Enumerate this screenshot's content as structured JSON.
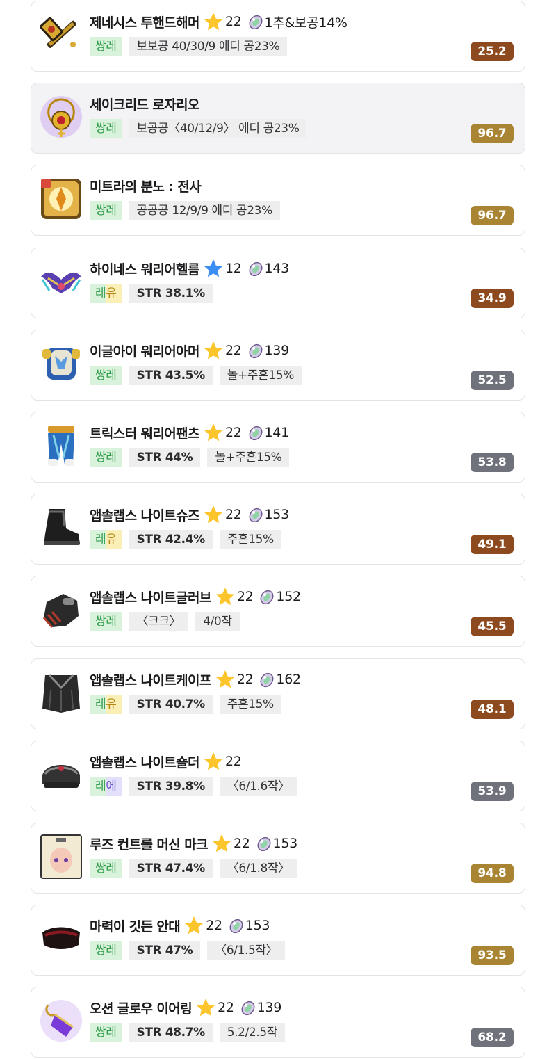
{
  "colors": {
    "score_brown": "#8e4a1f",
    "score_gold": "#a98432",
    "score_gray": "#6f717b",
    "star_gold": "#fdc52c",
    "star_blue": "#3b8ff2"
  },
  "items": [
    {
      "name": "제네시스 투핸드해머",
      "icon": "hammer-icon",
      "star": "gold",
      "stars": "22",
      "gem": "1추&보공14%",
      "rank": {
        "a": "쌍",
        "b": "레",
        "style": "green"
      },
      "tags": [
        {
          "text": "보보공 40/30/9 에디 공23%",
          "bold": false
        }
      ],
      "score": "25.2",
      "score_color": "brown",
      "highlighted": false
    },
    {
      "name": "세이크리드 로자리오",
      "icon": "rosary-icon",
      "star": null,
      "stars": null,
      "gem": null,
      "rank": {
        "a": "쌍",
        "b": "레",
        "style": "green"
      },
      "tags": [
        {
          "text": "보공공〈40/12/9〉 에디 공23%",
          "bold": false
        }
      ],
      "score": "96.7",
      "score_color": "gold",
      "highlighted": true
    },
    {
      "name": "미트라의 분노 : 전사",
      "icon": "emblem-icon",
      "star": null,
      "stars": null,
      "gem": null,
      "rank": {
        "a": "쌍",
        "b": "레",
        "style": "green"
      },
      "tags": [
        {
          "text": "공공공 12/9/9 에디 공23%",
          "bold": false
        }
      ],
      "score": "96.7",
      "score_color": "gold",
      "highlighted": false
    },
    {
      "name": "하이네스 워리어헬름",
      "icon": "helmet-icon",
      "star": "blue",
      "stars": "12",
      "gem": "143",
      "rank": {
        "a": "레",
        "b": "유",
        "style": "unique"
      },
      "tags": [
        {
          "text": "STR 38.1%",
          "bold": true
        }
      ],
      "score": "34.9",
      "score_color": "brown",
      "highlighted": false
    },
    {
      "name": "이글아이 워리어아머",
      "icon": "armor-icon",
      "star": "gold",
      "stars": "22",
      "gem": "139",
      "rank": {
        "a": "쌍",
        "b": "레",
        "style": "green"
      },
      "tags": [
        {
          "text": "STR 43.5%",
          "bold": true
        },
        {
          "text": "놀+주흔15%",
          "bold": false
        }
      ],
      "score": "52.5",
      "score_color": "gray",
      "highlighted": false
    },
    {
      "name": "트릭스터 워리어팬츠",
      "icon": "pants-icon",
      "star": "gold",
      "stars": "22",
      "gem": "141",
      "rank": {
        "a": "쌍",
        "b": "레",
        "style": "green"
      },
      "tags": [
        {
          "text": "STR 44%",
          "bold": true
        },
        {
          "text": "놀+주흔15%",
          "bold": false
        }
      ],
      "score": "53.8",
      "score_color": "gray",
      "highlighted": false
    },
    {
      "name": "앱솔랩스 나이트슈즈",
      "icon": "shoes-icon",
      "star": "gold",
      "stars": "22",
      "gem": "153",
      "rank": {
        "a": "레",
        "b": "유",
        "style": "unique"
      },
      "tags": [
        {
          "text": "STR 42.4%",
          "bold": true
        },
        {
          "text": "주흔15%",
          "bold": false
        }
      ],
      "score": "49.1",
      "score_color": "brown",
      "highlighted": false
    },
    {
      "name": "앱솔랩스 나이트글러브",
      "icon": "glove-icon",
      "star": "gold",
      "stars": "22",
      "gem": "152",
      "rank": {
        "a": "쌍",
        "b": "레",
        "style": "green"
      },
      "tags": [
        {
          "text": "〈크크〉",
          "bold": false
        },
        {
          "text": "4/0작",
          "bold": false
        }
      ],
      "score": "45.5",
      "score_color": "brown",
      "highlighted": false
    },
    {
      "name": "앱솔랩스 나이트케이프",
      "icon": "cape-icon",
      "star": "gold",
      "stars": "22",
      "gem": "162",
      "rank": {
        "a": "레",
        "b": "유",
        "style": "unique"
      },
      "tags": [
        {
          "text": "STR 40.7%",
          "bold": true
        },
        {
          "text": "주흔15%",
          "bold": false
        }
      ],
      "score": "48.1",
      "score_color": "brown",
      "highlighted": false
    },
    {
      "name": "앱솔랩스 나이트숄더",
      "icon": "shoulder-icon",
      "star": "gold",
      "stars": "22",
      "gem": null,
      "rank": {
        "a": "레",
        "b": "에",
        "style": "epic"
      },
      "tags": [
        {
          "text": "STR 39.8%",
          "bold": true
        },
        {
          "text": "〈6/1.6작〉",
          "bold": false
        }
      ],
      "score": "53.9",
      "score_color": "gray",
      "highlighted": false
    },
    {
      "name": "루즈 컨트롤 머신 마크",
      "icon": "face-accessory-icon",
      "star": "gold",
      "stars": "22",
      "gem": "153",
      "rank": {
        "a": "쌍",
        "b": "레",
        "style": "green"
      },
      "tags": [
        {
          "text": "STR 47.4%",
          "bold": true
        },
        {
          "text": "〈6/1.8작〉",
          "bold": false
        }
      ],
      "score": "94.8",
      "score_color": "gold",
      "highlighted": false
    },
    {
      "name": "마력이 깃든 안대",
      "icon": "eyepatch-icon",
      "star": "gold",
      "stars": "22",
      "gem": "153",
      "rank": {
        "a": "쌍",
        "b": "레",
        "style": "green"
      },
      "tags": [
        {
          "text": "STR 47%",
          "bold": true
        },
        {
          "text": "〈6/1.5작〉",
          "bold": false
        }
      ],
      "score": "93.5",
      "score_color": "gold",
      "highlighted": false
    },
    {
      "name": "오션 글로우 이어링",
      "icon": "earring-icon",
      "star": "gold",
      "stars": "22",
      "gem": "139",
      "rank": {
        "a": "쌍",
        "b": "레",
        "style": "green"
      },
      "tags": [
        {
          "text": "STR 48.7%",
          "bold": true
        },
        {
          "text": "5.2/2.5작",
          "bold": false
        }
      ],
      "score": "68.2",
      "score_color": "gray",
      "highlighted": false
    }
  ]
}
